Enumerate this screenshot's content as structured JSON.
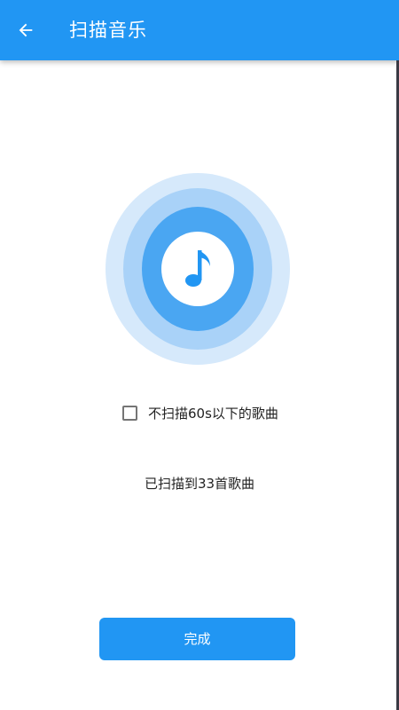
{
  "header": {
    "title": "扫描音乐",
    "back_icon": "arrow-left-icon"
  },
  "scan_graphic": {
    "icon": "music-note-icon",
    "colors": {
      "outer_ring": "#D6E9FB",
      "middle_ring": "#A9D2F8",
      "inner_ring": "#4AA6F2",
      "note": "#2196F3"
    }
  },
  "options": {
    "skip_short_label": "不扫描60s以下的歌曲",
    "skip_short_checked": false
  },
  "status": {
    "text": "已扫描到33首歌曲"
  },
  "actions": {
    "done_label": "完成"
  },
  "theme": {
    "primary": "#2196F3"
  }
}
